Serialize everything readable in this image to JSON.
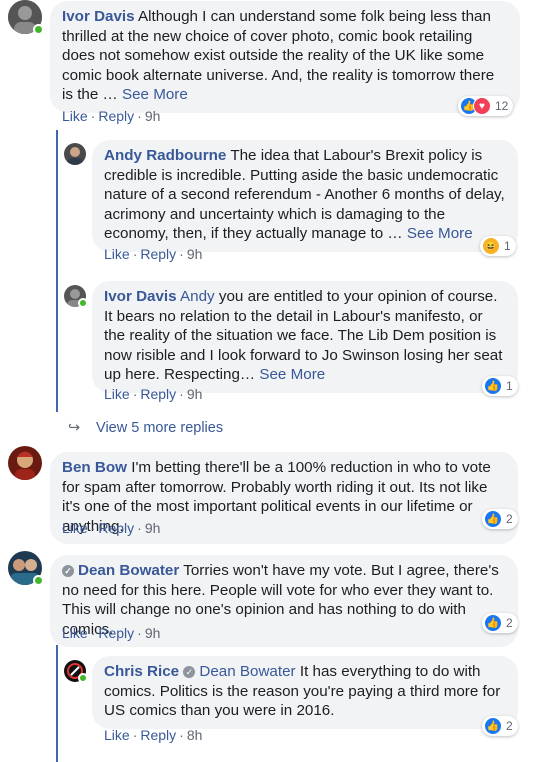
{
  "comments": {
    "c1": {
      "author": "Ivor Davis",
      "text": "Although I can understand some folk being less than thrilled at the new choice of cover photo, comic book retailing does not somehow exist outside the reality of the UK like some comic book alternate universe. And, the reality is tomorrow there is the …",
      "see_more": "See More",
      "like": "Like",
      "reply": "Reply",
      "time": "9h",
      "reactions": [
        "like-icon",
        "love-icon"
      ],
      "reaction_count": "12"
    },
    "c2": {
      "author": "Andy Radbourne",
      "text": "The idea that Labour's Brexit policy is credible is incredible. Putting aside the basic undemocratic nature of a second referendum - Another 6 months of delay, acrimony and uncertainty which is damaging to the economy, then, if they actually manage to …",
      "see_more": "See More",
      "like": "Like",
      "reply": "Reply",
      "time": "9h",
      "reactions": [
        "haha-icon"
      ],
      "reaction_count": "1"
    },
    "c3": {
      "author": "Ivor Davis",
      "mention": "Andy",
      "text": "you are entitled to your opinion of course. It bears no relation to the detail in Labour's manifesto, or the reality of the situation we face. The Lib Dem position is now risible and I look forward to Jo Swinson losing her seat up here. Respecting…",
      "see_more": "See More",
      "like": "Like",
      "reply": "Reply",
      "time": "9h",
      "reactions": [
        "like-icon"
      ],
      "reaction_count": "1"
    },
    "view_more": "View 5 more replies",
    "c4": {
      "author": "Ben Bow",
      "text": "I'm betting there'll be a 100% reduction in who to vote for spam after tomorrow. Probably worth riding it out. Its not like it's one of the most important political events in our lifetime or anything.",
      "like": "Like",
      "reply": "Reply",
      "time": "9h",
      "reactions": [
        "like-icon"
      ],
      "reaction_count": "2"
    },
    "c5": {
      "author": "Dean Bowater",
      "text": "Torries won't have my vote. But I agree, there's no need for this here. People will vote for who ever they want to. This will change no one's opinion and has nothing to do with comics.",
      "like": "Like",
      "reply": "Reply",
      "time": "9h",
      "reactions": [
        "like-icon"
      ],
      "reaction_count": "2"
    },
    "c6": {
      "author": "Chris Rice",
      "mention": "Dean Bowater",
      "text": "It has everything to do with comics. Politics is the reason you're paying a third more for US comics than you were in 2016.",
      "like": "Like",
      "reply": "Reply",
      "time": "8h",
      "reactions": [
        "like-icon"
      ],
      "reaction_count": "2"
    }
  },
  "colors": {
    "link": "#385898",
    "bubble": "#f2f3f5",
    "thread_line": "#4267b2",
    "like_blue": "#1877f2"
  }
}
